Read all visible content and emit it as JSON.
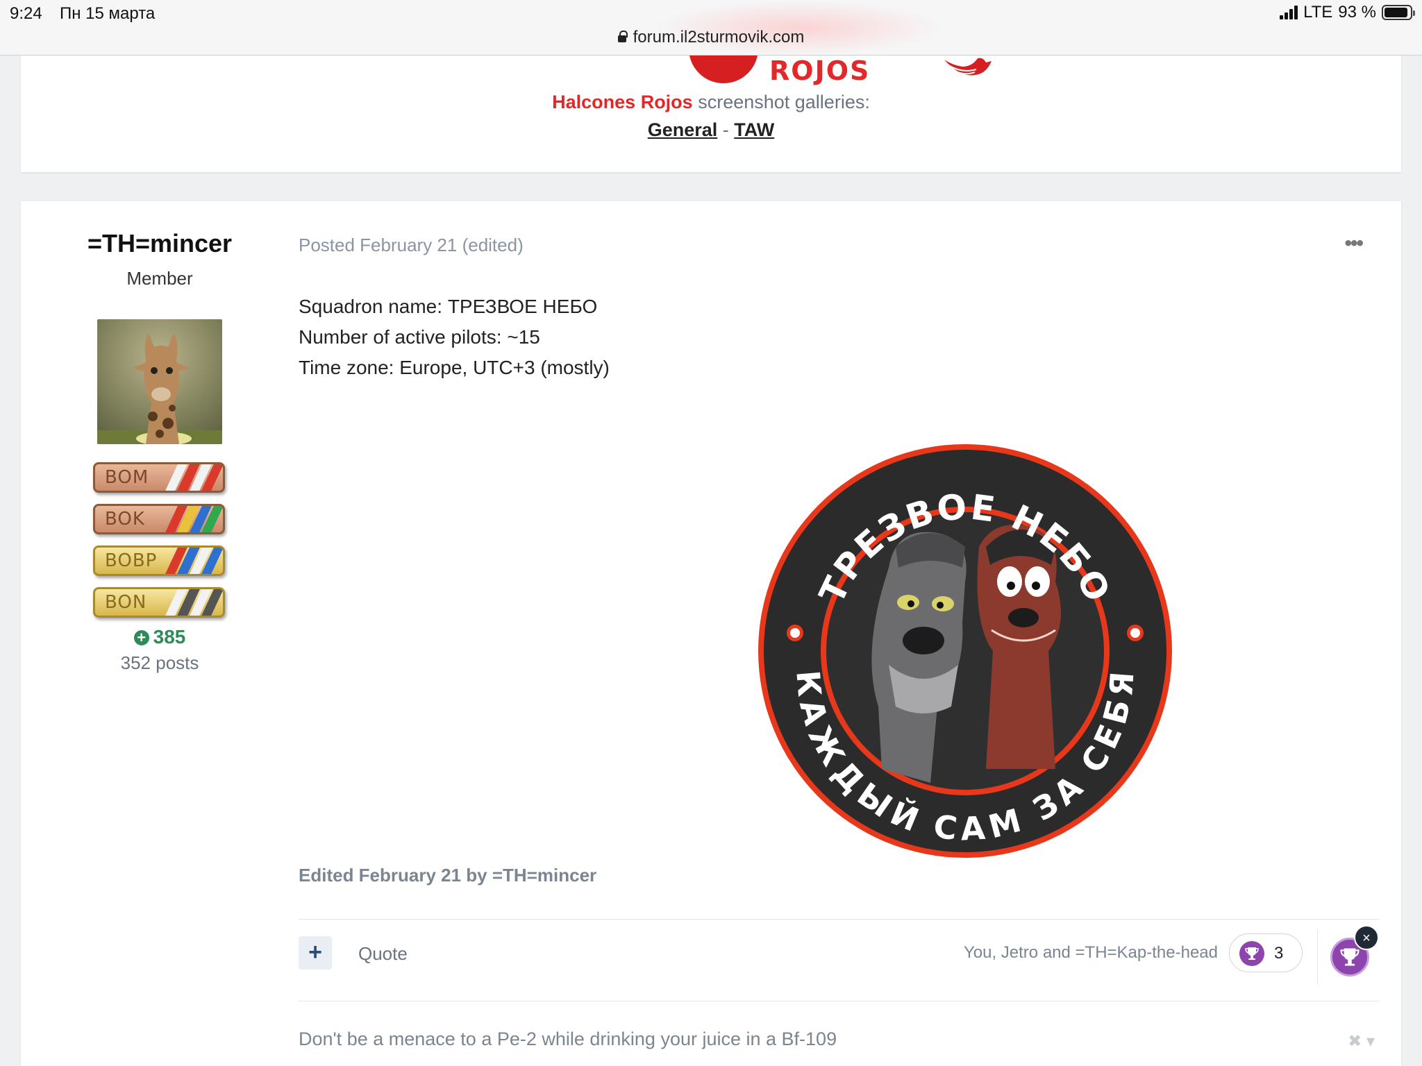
{
  "status_bar": {
    "time": "9:24",
    "date": "Пн 15 марта",
    "network": "LTE",
    "battery": "93 %",
    "battery_level": 0.93,
    "url": "forum.il2sturmovik.com"
  },
  "prev_signature": {
    "logo_text": "ROJOS",
    "squadron": "Halcones Rojos",
    "gallery_text": " screenshot galleries:",
    "link_general": "General",
    "link_sep": " - ",
    "link_taw": "TAW"
  },
  "post": {
    "author": {
      "name": "=TH=mincer",
      "rank": "Member",
      "badges": [
        {
          "label": "BOM",
          "style": "cu",
          "stripes": [
            "#f2f2f2",
            "#d93a2b",
            "#f2f2f2",
            "#d93a2b"
          ]
        },
        {
          "label": "BOK",
          "style": "cu",
          "stripes": [
            "#d93a2b",
            "#e9c13b",
            "#2f6fd0",
            "#2fa84f"
          ]
        },
        {
          "label": "BOBP",
          "style": "au",
          "stripes": [
            "#d93a2b",
            "#2f6fd0",
            "#f2f2f2",
            "#2f6fd0"
          ]
        },
        {
          "label": "BON",
          "style": "au",
          "stripes": [
            "#f2f2f2",
            "#555555",
            "#f2f2f2",
            "#555555"
          ]
        }
      ],
      "reputation": "385",
      "posts": "352 posts"
    },
    "meta": "Posted February 21 (edited)",
    "body": {
      "line1": "Squadron name: ТРЕЗВОЕ НЕБО",
      "line2": "Number of active pilots: ~15",
      "line3": "Time zone: Europe, UTC+3 (mostly)"
    },
    "patch": {
      "top_text": "ТРЕЗВОЕ НЕБО",
      "bottom_text": "КАЖДЫЙ САМ ЗА СЕБЯ"
    },
    "edited_note": "Edited February 21 by =TH=mincer",
    "actions": {
      "quote": "Quote",
      "reacted_by": "You, Jetro and =TH=Kap-the-head",
      "reaction_count": "3"
    },
    "signature": "Don't be a menace to a Pe-2 while drinking your juice in a Bf-109"
  },
  "colors": {
    "accent_red": "#e32727",
    "reputation_green": "#2e8b57",
    "reaction_purple": "#8e44ad",
    "patch_red": "#e8381c"
  }
}
